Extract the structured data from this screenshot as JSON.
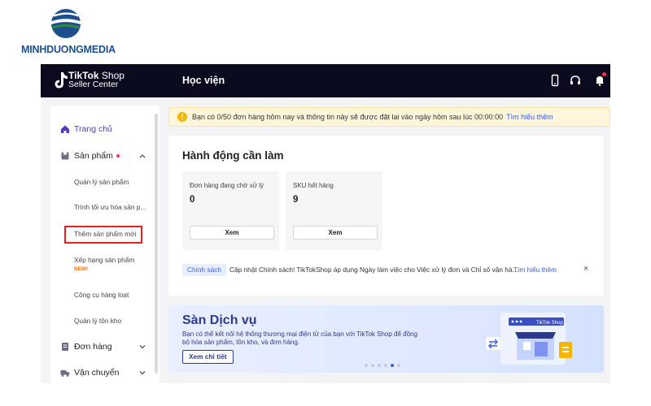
{
  "watermark": {
    "brand_part1": "MINHDUONG",
    "brand_part2": "MEDIA"
  },
  "topbar": {
    "brand_line1_bold": "TikTok",
    "brand_line1_rest": " Shop",
    "brand_line2": "Seller Center",
    "title": "Học viện"
  },
  "sidebar": {
    "home": "Trang chủ",
    "products": "Sản phẩm",
    "product_items": [
      "Quản lý sản phẩm",
      "Trình tối ưu hóa sản p...",
      "Thêm sản phẩm mới",
      "Xếp hạng sản phẩm",
      "Công cụ hàng loạt",
      "Quản lý tồn kho"
    ],
    "new_badge": "NEW!",
    "orders": "Đơn hàng",
    "shipping": "Vận chuyển"
  },
  "notice": {
    "text": "Bạn có 0/50 đơn hàng hôm nay và thông tin này sẽ được đặt lại vào ngày hôm sau lúc 00:00:00",
    "link": "Tìm hiểu thêm"
  },
  "actions": {
    "title": "Hành động cần làm",
    "stats": [
      {
        "label": "Đơn hàng đang chờ xử lý",
        "value": "0",
        "button": "Xem"
      },
      {
        "label": "SKU hết hàng",
        "value": "9",
        "button": "Xem"
      }
    ],
    "policy_tag": "Chính sách",
    "policy_text": "Cập nhật Chính sách! TikTokShop áp dụng Ngày làm việc cho Việc xử lý đơn và Chỉ số vận hà...",
    "policy_link": "Tìm hiểu thêm",
    "close": "×"
  },
  "banner": {
    "title": "Sàn Dịch vụ",
    "desc": "Bạn có thể kết nối hệ thống thương mại điện tử của bạn với TikTok Shop để đồng bộ hóa sản phẩm, tồn kho, và đơn hàng.",
    "button": "Xem chi tiết",
    "art_label": "TikTok Shop",
    "slides_total": 6,
    "slide_active_index": 4
  },
  "colors": {
    "accent": "#4a3ec8",
    "topbar": "#0b0b1f",
    "highlight": "#e4201e",
    "link": "#3b5bdb"
  }
}
